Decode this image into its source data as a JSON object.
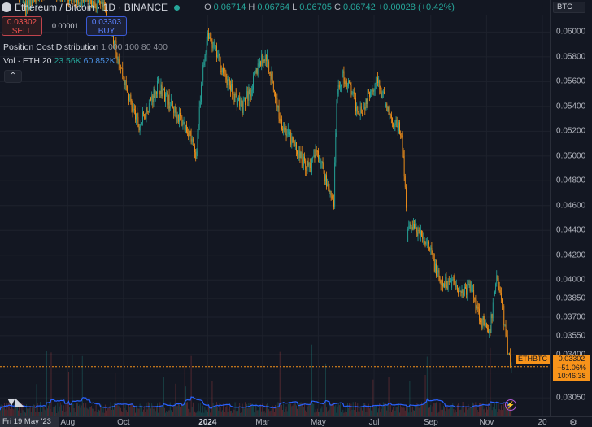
{
  "header": {
    "title": "Ethereum / Bitcoin · 1D · BINANCE",
    "ohlc": [
      {
        "label": "O",
        "value": "0.06714"
      },
      {
        "label": "H",
        "value": "0.06764"
      },
      {
        "label": "L",
        "value": "0.06705"
      },
      {
        "label": "C",
        "value": "0.06742"
      }
    ],
    "change": "+0.00028 (+0.42%)"
  },
  "trade": {
    "sell_price": "0.03302",
    "sell_label": "SELL",
    "spread": "0.00001",
    "buy_price": "0.03303",
    "buy_label": "BUY"
  },
  "indicators": {
    "pcd_name": "Position Cost Distribution",
    "pcd_params": "1,000 100 80 400",
    "vol_name": "Vol · ETH 20",
    "vol_value1": "23.56K",
    "vol_value2": "60.852K",
    "collapse_glyph": "⌃"
  },
  "price_axis": {
    "quote_currency": "BTC",
    "symbol": "ETHBTC",
    "last_price": "0.03302",
    "last_change": "−51.06%",
    "countdown": "10:46:38"
  },
  "time_axis": {
    "crosshair_date": "Fri 19 May '23"
  },
  "colors": {
    "background": "#131722",
    "up": "#26a69a",
    "down": "#f7931a",
    "volume_ma": "#2962ff",
    "last_price": "#f7931a"
  },
  "chart_data": {
    "type": "candlestick",
    "symbol": "ETHBTC",
    "interval": "1D",
    "exchange": "BINANCE",
    "yaxis_ticks": [
      "0.06000",
      "0.05800",
      "0.05600",
      "0.05400",
      "0.05200",
      "0.05000",
      "0.04800",
      "0.04600",
      "0.04400",
      "0.04200",
      "0.04000",
      "0.03850",
      "0.03700",
      "0.03550",
      "0.03400",
      "0.03250",
      "0.03050"
    ],
    "xaxis_ticks": [
      "Aug",
      "Oct",
      "2024",
      "Mar",
      "May",
      "Jul",
      "Sep",
      "Nov",
      "20"
    ],
    "xaxis_bold": [
      "2024"
    ],
    "ylim": [
      0.029,
      0.0614
    ],
    "last_price": 0.03302,
    "close_path": [
      {
        "date": "2023-05-19",
        "price": 0.0665
      },
      {
        "date": "2023-06-15",
        "price": 0.062
      },
      {
        "date": "2023-07-10",
        "price": 0.0636
      },
      {
        "date": "2023-08-01",
        "price": 0.063
      },
      {
        "date": "2023-08-20",
        "price": 0.0627
      },
      {
        "date": "2023-09-10",
        "price": 0.0618
      },
      {
        "date": "2023-09-26",
        "price": 0.0578
      },
      {
        "date": "2023-10-05",
        "price": 0.0552
      },
      {
        "date": "2023-10-18",
        "price": 0.0523
      },
      {
        "date": "2023-10-30",
        "price": 0.0544
      },
      {
        "date": "2023-11-08",
        "price": 0.0558
      },
      {
        "date": "2023-11-22",
        "price": 0.0541
      },
      {
        "date": "2023-12-02",
        "price": 0.053
      },
      {
        "date": "2023-12-12",
        "price": 0.0519
      },
      {
        "date": "2023-12-19",
        "price": 0.05
      },
      {
        "date": "2023-12-27",
        "price": 0.057
      },
      {
        "date": "2024-01-01",
        "price": 0.06
      },
      {
        "date": "2024-01-07",
        "price": 0.059
      },
      {
        "date": "2024-01-18",
        "price": 0.0568
      },
      {
        "date": "2024-01-29",
        "price": 0.055
      },
      {
        "date": "2024-02-08",
        "price": 0.054
      },
      {
        "date": "2024-02-18",
        "price": 0.0555
      },
      {
        "date": "2024-02-26",
        "price": 0.0575
      },
      {
        "date": "2024-03-05",
        "price": 0.058
      },
      {
        "date": "2024-03-12",
        "price": 0.056
      },
      {
        "date": "2024-03-20",
        "price": 0.053
      },
      {
        "date": "2024-04-03",
        "price": 0.051
      },
      {
        "date": "2024-04-15",
        "price": 0.0495
      },
      {
        "date": "2024-04-22",
        "price": 0.049
      },
      {
        "date": "2024-04-30",
        "price": 0.0505
      },
      {
        "date": "2024-05-08",
        "price": 0.0485
      },
      {
        "date": "2024-05-18",
        "price": 0.0462
      },
      {
        "date": "2024-05-21",
        "price": 0.0545
      },
      {
        "date": "2024-05-27",
        "price": 0.0565
      },
      {
        "date": "2024-06-05",
        "price": 0.0555
      },
      {
        "date": "2024-06-12",
        "price": 0.0538
      },
      {
        "date": "2024-06-20",
        "price": 0.054
      },
      {
        "date": "2024-06-27",
        "price": 0.0555
      },
      {
        "date": "2024-07-04",
        "price": 0.056
      },
      {
        "date": "2024-07-12",
        "price": 0.0545
      },
      {
        "date": "2024-07-20",
        "price": 0.053
      },
      {
        "date": "2024-07-30",
        "price": 0.052
      },
      {
        "date": "2024-08-04",
        "price": 0.048
      },
      {
        "date": "2024-08-06",
        "price": 0.0435
      },
      {
        "date": "2024-08-10",
        "price": 0.0445
      },
      {
        "date": "2024-08-22",
        "price": 0.0435
      },
      {
        "date": "2024-09-02",
        "price": 0.042
      },
      {
        "date": "2024-09-12",
        "price": 0.0395
      },
      {
        "date": "2024-09-25",
        "price": 0.04
      },
      {
        "date": "2024-10-05",
        "price": 0.039
      },
      {
        "date": "2024-10-15",
        "price": 0.0395
      },
      {
        "date": "2024-10-25",
        "price": 0.037
      },
      {
        "date": "2024-11-04",
        "price": 0.0355
      },
      {
        "date": "2024-11-12",
        "price": 0.0405
      },
      {
        "date": "2024-11-18",
        "price": 0.038
      },
      {
        "date": "2024-11-23",
        "price": 0.035
      },
      {
        "date": "2024-11-28",
        "price": 0.033
      }
    ]
  }
}
